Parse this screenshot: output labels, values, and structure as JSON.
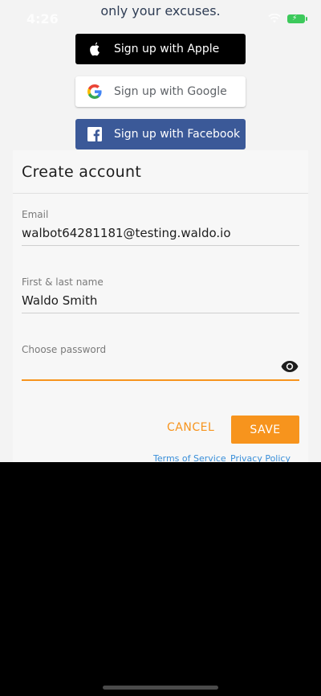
{
  "status_bar": {
    "time": "4:26"
  },
  "tagline": "only your excuses.",
  "social": {
    "apple_label": "Sign up with Apple",
    "google_label": "Sign up with Google",
    "facebook_label": "Sign up with Facebook"
  },
  "form": {
    "title": "Create account",
    "email": {
      "label": "Email",
      "value": "walbot64281181@testing.waldo.io"
    },
    "name": {
      "label": "First & last name",
      "value": "Waldo Smith"
    },
    "password": {
      "label": "Choose password",
      "value": ""
    },
    "cancel_label": "CANCEL",
    "save_label": "SAVE",
    "terms_label": "Terms of Service",
    "privacy_label": "Privacy Policy"
  },
  "colors": {
    "accent": "#f7941d",
    "facebook": "#3b5998",
    "link": "#3a8fd9"
  }
}
